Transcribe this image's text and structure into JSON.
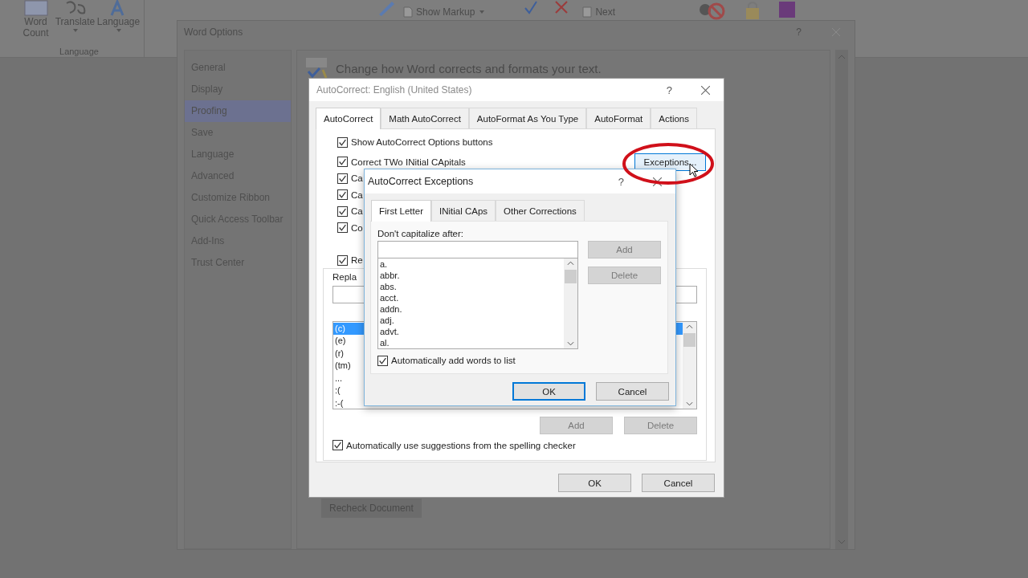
{
  "ribbon": {
    "language_group": {
      "label": "Language",
      "buttons": [
        {
          "label": "Word Count",
          "kind": "count",
          "dropdown": false
        },
        {
          "label": "Translate",
          "kind": "translate",
          "dropdown": true
        },
        {
          "label": "Language",
          "kind": "language",
          "dropdown": true
        }
      ]
    },
    "show_markup": "Show Markup",
    "next": "Next"
  },
  "word_options": {
    "title": "Word Options",
    "help": "?",
    "nav": [
      {
        "label": "General",
        "selected": false
      },
      {
        "label": "Display",
        "selected": false
      },
      {
        "label": "Proofing",
        "selected": true
      },
      {
        "label": "Save",
        "selected": false
      },
      {
        "label": "Language",
        "selected": false
      },
      {
        "label": "Advanced",
        "selected": false
      },
      {
        "label": "Customize Ribbon",
        "selected": false
      },
      {
        "label": "Quick Access Toolbar",
        "selected": false
      },
      {
        "label": "Add-Ins",
        "selected": false
      },
      {
        "label": "Trust Center",
        "selected": false
      }
    ],
    "heading": "Change how Word corrects and formats your text.",
    "recheck_button": "Recheck Document"
  },
  "autocorrect": {
    "title": "AutoCorrect: English (United States)",
    "help": "?",
    "tabs": [
      {
        "label": "AutoCorrect",
        "selected": true
      },
      {
        "label": "Math AutoCorrect",
        "selected": false
      },
      {
        "label": "AutoFormat As You Type",
        "selected": false
      },
      {
        "label": "AutoFormat",
        "selected": false
      },
      {
        "label": "Actions",
        "selected": false
      }
    ],
    "options": [
      {
        "label": "Show AutoCorrect Options buttons",
        "checked": true
      },
      {
        "label": "Correct TWo INitial CApitals",
        "checked": true
      },
      {
        "label": "Ca",
        "checked": true
      },
      {
        "label": "Ca",
        "checked": true
      },
      {
        "label": "Ca",
        "checked": true
      },
      {
        "label": "Co",
        "checked": true
      }
    ],
    "exceptions_button": "Exceptions...",
    "replace_option": {
      "label": "Re",
      "checked": true
    },
    "replace_label": "Repla",
    "entries": [
      {
        "text": "(c)",
        "selected": true
      },
      {
        "text": "(e)",
        "selected": false
      },
      {
        "text": "(r)",
        "selected": false
      },
      {
        "text": "(tm)",
        "selected": false
      },
      {
        "text": "...",
        "selected": false
      },
      {
        "text": ":(",
        "selected": false
      },
      {
        "text": ":-(",
        "selected": false
      }
    ],
    "add_button": {
      "label": "Add",
      "disabled": true
    },
    "delete_button": {
      "label": "Delete",
      "disabled": true
    },
    "suggestions": {
      "label": "Automatically use suggestions from the spelling checker",
      "checked": true
    },
    "ok": "OK",
    "cancel": "Cancel"
  },
  "exceptions": {
    "title": "AutoCorrect Exceptions",
    "help": "?",
    "tabs": [
      {
        "label": "First Letter",
        "selected": true
      },
      {
        "label": "INitial CAps",
        "selected": false
      },
      {
        "label": "Other Corrections",
        "selected": false
      }
    ],
    "field_label": "Don't capitalize after:",
    "words": [
      "a.",
      "abbr.",
      "abs.",
      "acct.",
      "addn.",
      "adj.",
      "advt.",
      "al."
    ],
    "add_button": {
      "label": "Add",
      "disabled": true
    },
    "delete_button": {
      "label": "Delete",
      "disabled": true
    },
    "auto_add": {
      "label": "Automatically add words to list",
      "checked": true
    },
    "ok": "OK",
    "cancel": "Cancel"
  }
}
